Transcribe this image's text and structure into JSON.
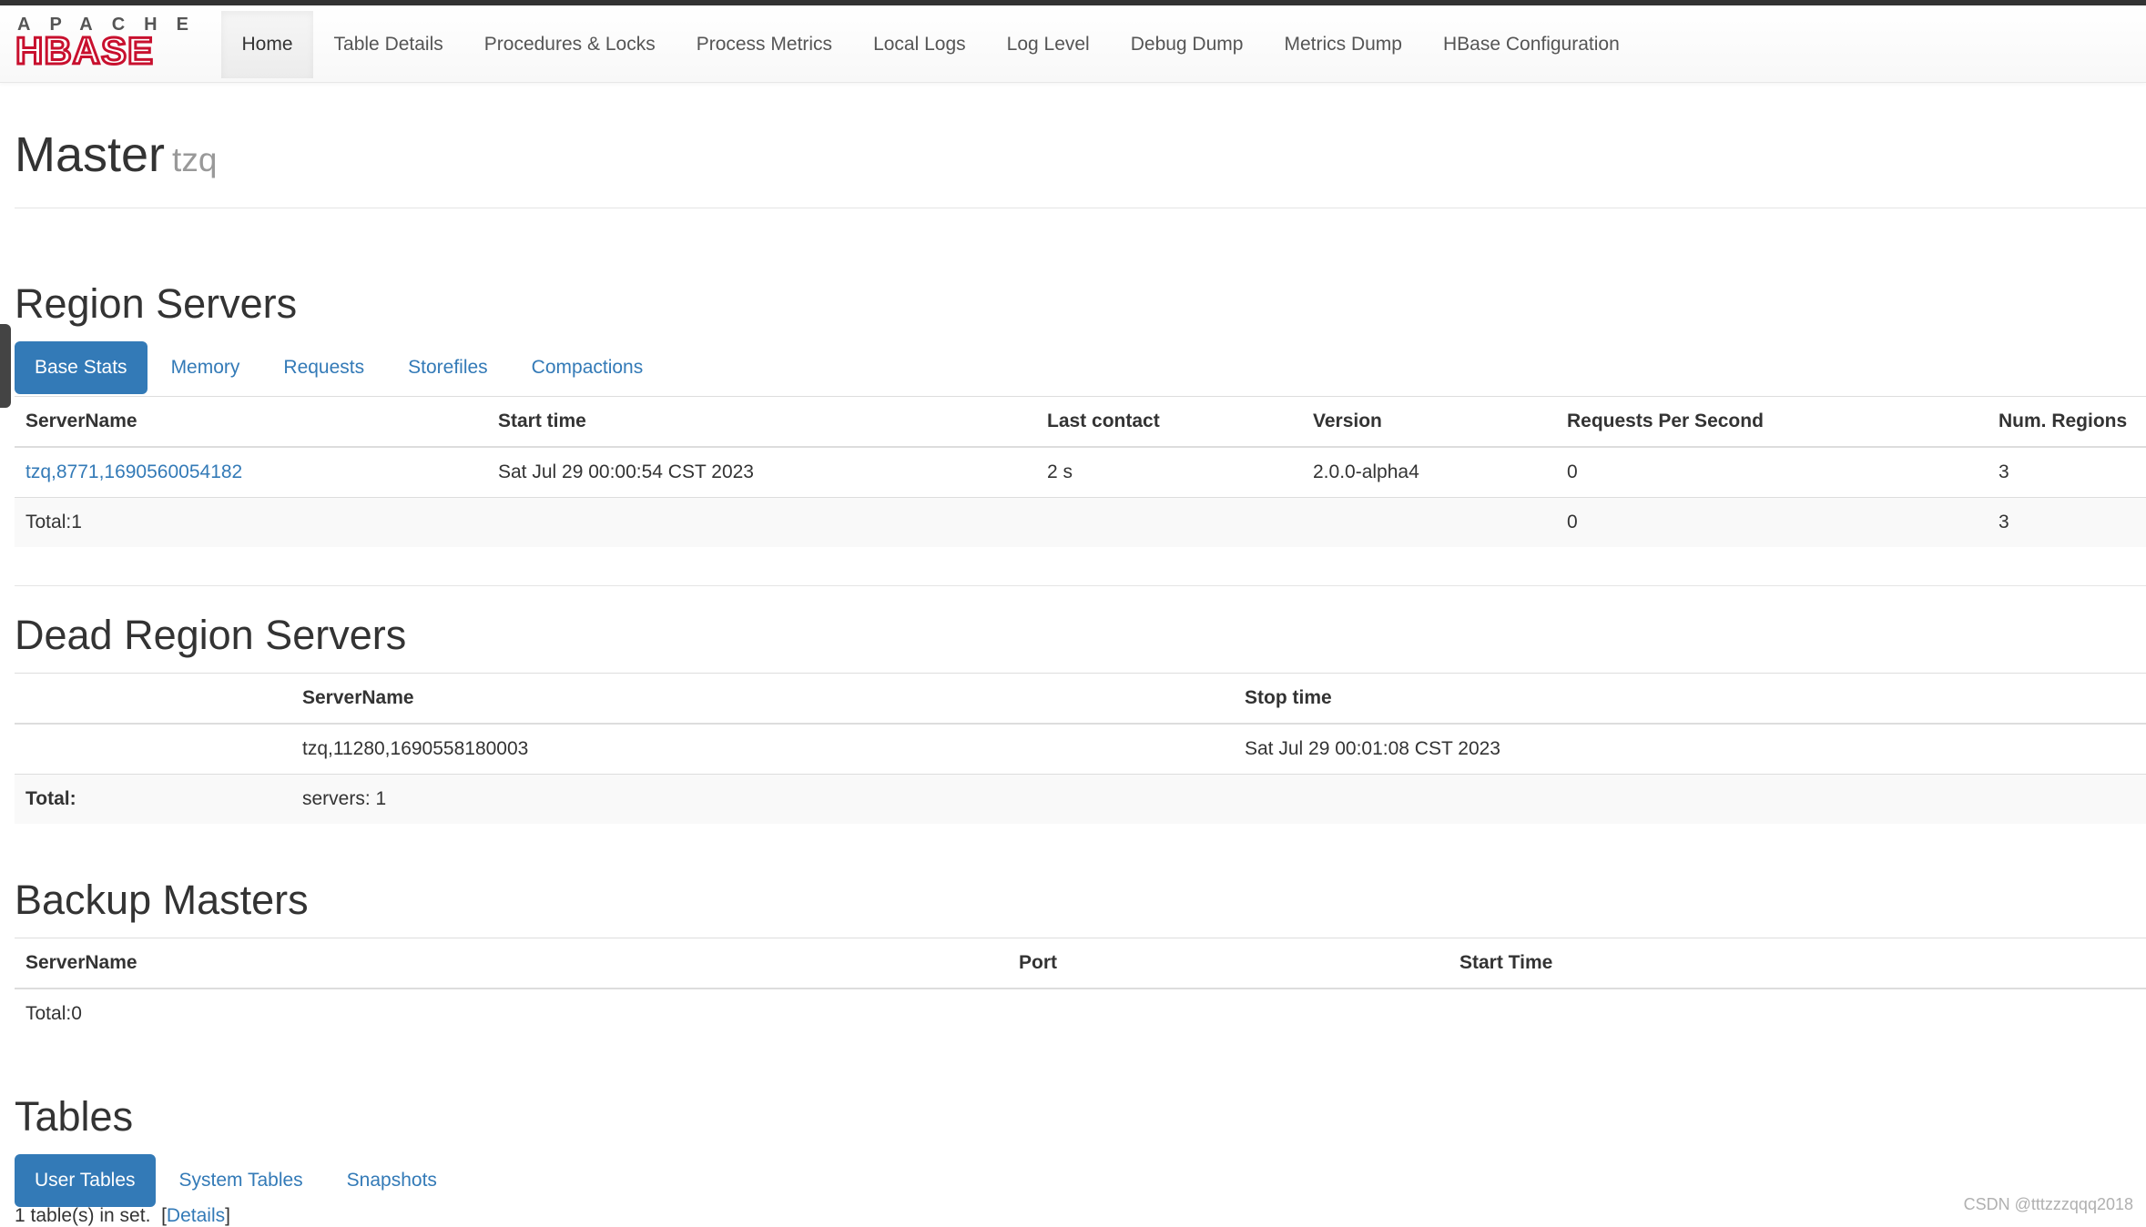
{
  "brand": {
    "logo_top": "APACHE",
    "logo_main": "HBASE",
    "colors": {
      "logo_red": "#c8102e",
      "logo_gray": "#555555"
    }
  },
  "nav": {
    "items": [
      {
        "label": "Home",
        "active": true
      },
      {
        "label": "Table Details"
      },
      {
        "label": "Procedures & Locks"
      },
      {
        "label": "Process Metrics"
      },
      {
        "label": "Local Logs"
      },
      {
        "label": "Log Level"
      },
      {
        "label": "Debug Dump"
      },
      {
        "label": "Metrics Dump"
      },
      {
        "label": "HBase Configuration"
      }
    ]
  },
  "header": {
    "title": "Master",
    "subtitle": "tzq"
  },
  "region_servers": {
    "heading": "Region Servers",
    "tabs": [
      "Base Stats",
      "Memory",
      "Requests",
      "Storefiles",
      "Compactions"
    ],
    "columns": [
      "ServerName",
      "Start time",
      "Last contact",
      "Version",
      "Requests Per Second",
      "Num. Regions"
    ],
    "rows": [
      {
        "server": "tzq,8771,1690560054182",
        "start_time": "Sat Jul 29 00:00:54 CST 2023",
        "last_contact": "2 s",
        "version": "2.0.0-alpha4",
        "rps": "0",
        "regions": "3"
      }
    ],
    "total": {
      "label": "Total:1",
      "rps": "0",
      "regions": "3"
    }
  },
  "dead_region_servers": {
    "heading": "Dead Region Servers",
    "columns": [
      "",
      "ServerName",
      "Stop time"
    ],
    "rows": [
      {
        "blank": "",
        "server": "tzq,11280,1690558180003",
        "stop_time": "Sat Jul 29 00:01:08 CST 2023"
      }
    ],
    "total": {
      "label": "Total:",
      "value": "servers: 1"
    }
  },
  "backup_masters": {
    "heading": "Backup Masters",
    "columns": [
      "ServerName",
      "Port",
      "Start Time"
    ],
    "total": "Total:0"
  },
  "tables": {
    "heading": "Tables",
    "tabs": [
      "User Tables",
      "System Tables",
      "Snapshots"
    ],
    "count_text": "1 table(s) in set.",
    "details_open": "[",
    "details_link": "Details",
    "details_close": "]"
  },
  "watermark": "CSDN @tttzzzqqq2018",
  "colors": {
    "link": "#337ab7",
    "active_pill_bg": "#337ab7",
    "striped_row": "#f9f9f9"
  }
}
